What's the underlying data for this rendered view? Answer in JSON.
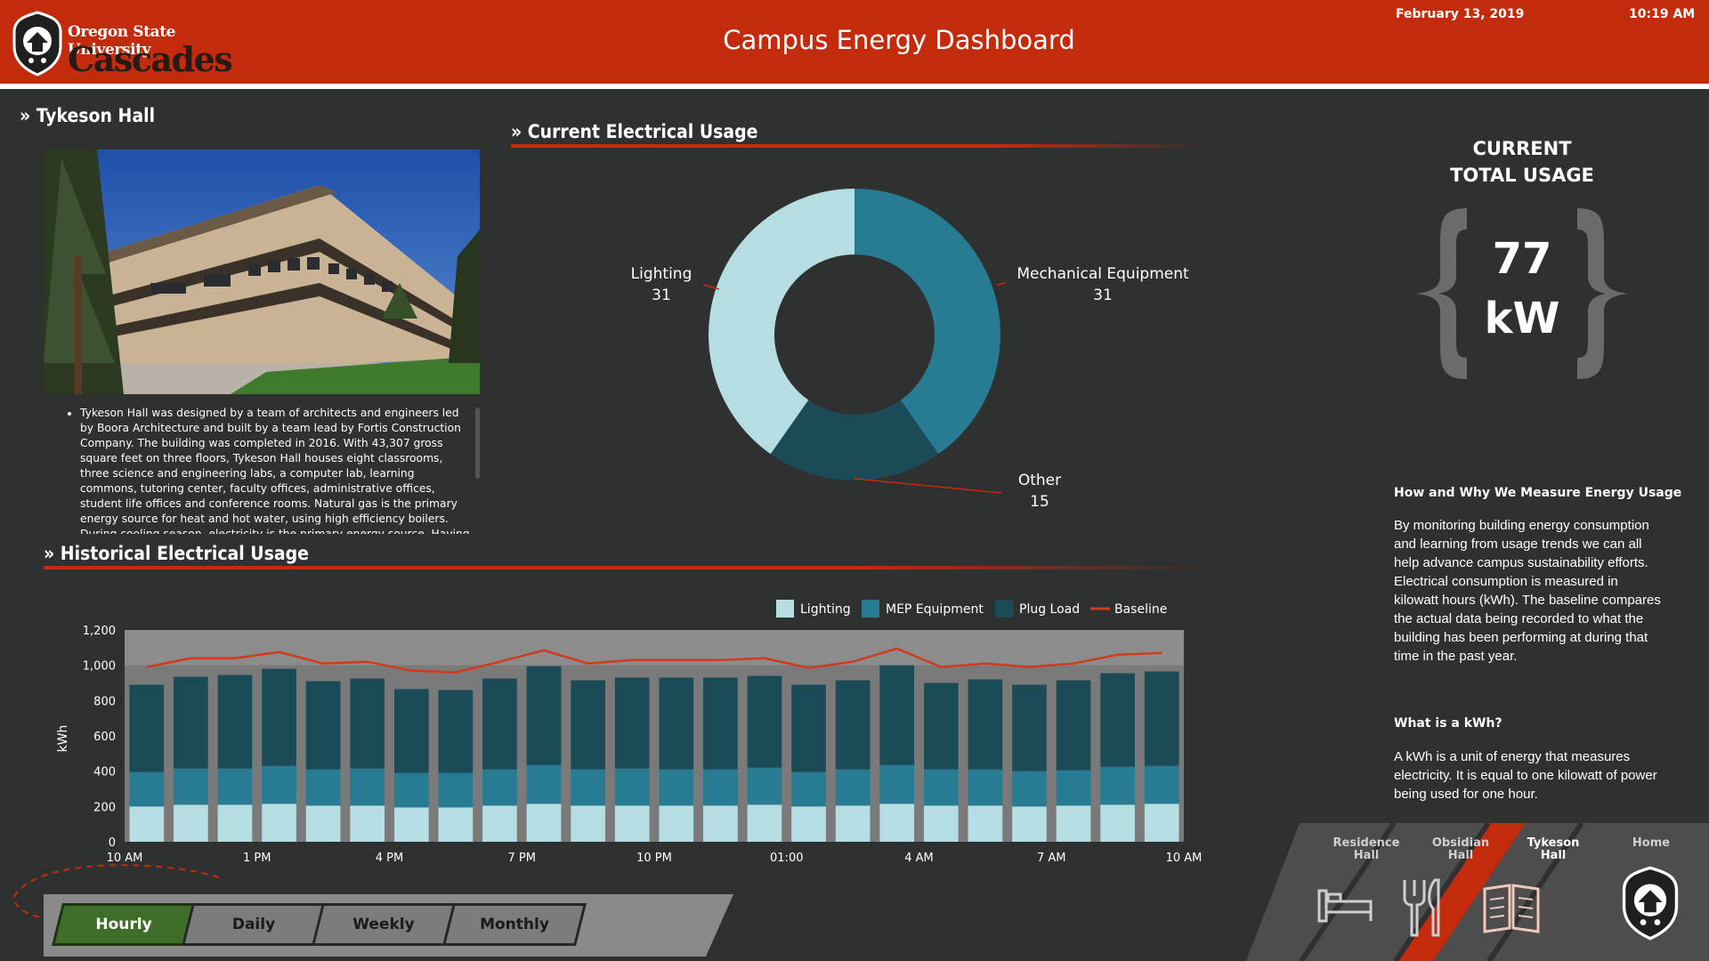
{
  "header": {
    "university": "Oregon State University",
    "campus": "Cascades",
    "title": "Campus Energy Dashboard",
    "date": "February 13, 2019",
    "time": "10:19 AM"
  },
  "building": {
    "heading": "» Tykeson Hall",
    "photo_icon": "building-photo",
    "description": "Tykeson Hall was designed by a team of architects and engineers led by Boora Architecture and built by a team lead by Fortis Construction Company. The building was completed in 2016. With 43,307 gross square feet on three floors, Tykeson Hall houses eight classrooms, three science and engineering labs, a computer lab, learning commons, tutoring center, faculty offices, administrative offices, student life offices and conference rooms. Natural gas is the primary energy source for heat and hot water, using high efficiency boilers. During cooling season, electricity is the primary energy source. Having labs in the building introduces an additional"
  },
  "current_usage": {
    "heading": "» Current Electrical Usage",
    "labels": [
      {
        "name": "Lighting",
        "value": "31"
      },
      {
        "name": "Mechanical Equipment",
        "value": "31"
      },
      {
        "name": "Other",
        "value": "15"
      }
    ]
  },
  "total": {
    "title_line1": "CURRENT",
    "title_line2": "TOTAL USAGE",
    "value": "77",
    "unit": "kW"
  },
  "info": {
    "heading1": "How and Why We Measure Energy Usage",
    "paragraph1": "By monitoring building energy consumption and learning from usage trends we can all help advance campus sustainability efforts. Electrical consumption is measured in kilowatt hours (kWh). The baseline compares the actual data being recorded to what the building has been performing at during that time in the past year.",
    "heading2": "What is a kWh?",
    "paragraph2": "A kWh is a unit of energy that measures electricity. It is equal to one kilowatt of power being used for one hour."
  },
  "historical": {
    "heading": "» Historical Electrical Usage",
    "legend": {
      "lighting": "Lighting",
      "mep": "MEP Equipment",
      "plug": "Plug Load",
      "baseline": "Baseline"
    }
  },
  "buttons": {
    "hourly": "Hourly",
    "daily": "Daily",
    "weekly": "Weekly",
    "monthly": "Monthly"
  },
  "nav": {
    "residence_line1": "Residence",
    "residence_line2": "Hall",
    "obsidian_line1": "Obsidian",
    "obsidian_line2": "Hall",
    "tykeson_line1": "Tykeson",
    "tykeson_line2": "Hall",
    "home": "Home"
  },
  "colors": {
    "header": "#c42b0d",
    "lighting": "#b6dde2",
    "mep": "#277b93",
    "plug": "#1c4b58",
    "baseline": "#d23a1c",
    "active_button": "#3f6d2a"
  },
  "chart_data": [
    {
      "type": "pie",
      "title": "» Current Electrical Usage",
      "categories": [
        "Lighting",
        "Mechanical Equipment",
        "Other"
      ],
      "values": [
        31,
        31,
        15
      ],
      "colors": [
        "#b6dde2",
        "#277b93",
        "#1c4b58"
      ]
    },
    {
      "type": "bar",
      "title": "» Historical Electrical Usage",
      "stacked": true,
      "ylabel": "kWh",
      "ylim": [
        0,
        1200
      ],
      "yticks": [
        "0",
        "200",
        "400",
        "600",
        "800",
        "1,000",
        "1,200"
      ],
      "xtick_labels": [
        "10 AM",
        "1 PM",
        "4 PM",
        "7 PM",
        "10 PM",
        "01:00",
        "4 AM",
        "7 AM",
        "10 AM"
      ],
      "legend_position": "top-right",
      "grid": false,
      "series": [
        {
          "name": "Lighting",
          "values": [
            200,
            210,
            210,
            215,
            205,
            205,
            195,
            195,
            205,
            215,
            205,
            205,
            205,
            205,
            210,
            200,
            205,
            215,
            205,
            205,
            200,
            205,
            210,
            215
          ]
        },
        {
          "name": "MEP Equipment",
          "values": [
            195,
            205,
            205,
            215,
            205,
            210,
            195,
            195,
            205,
            220,
            205,
            210,
            205,
            205,
            210,
            195,
            205,
            220,
            205,
            205,
            200,
            200,
            215,
            215
          ]
        },
        {
          "name": "Plug Load",
          "values": [
            495,
            520,
            530,
            550,
            500,
            510,
            475,
            470,
            515,
            560,
            505,
            515,
            520,
            520,
            520,
            495,
            505,
            565,
            490,
            510,
            490,
            510,
            530,
            535
          ]
        },
        {
          "name": "Baseline",
          "type": "line",
          "values": [
            990,
            1040,
            1040,
            1075,
            1010,
            1020,
            970,
            960,
            1020,
            1085,
            1010,
            1030,
            1030,
            1030,
            1040,
            985,
            1020,
            1095,
            990,
            1010,
            990,
            1010,
            1060,
            1070
          ]
        }
      ]
    }
  ]
}
